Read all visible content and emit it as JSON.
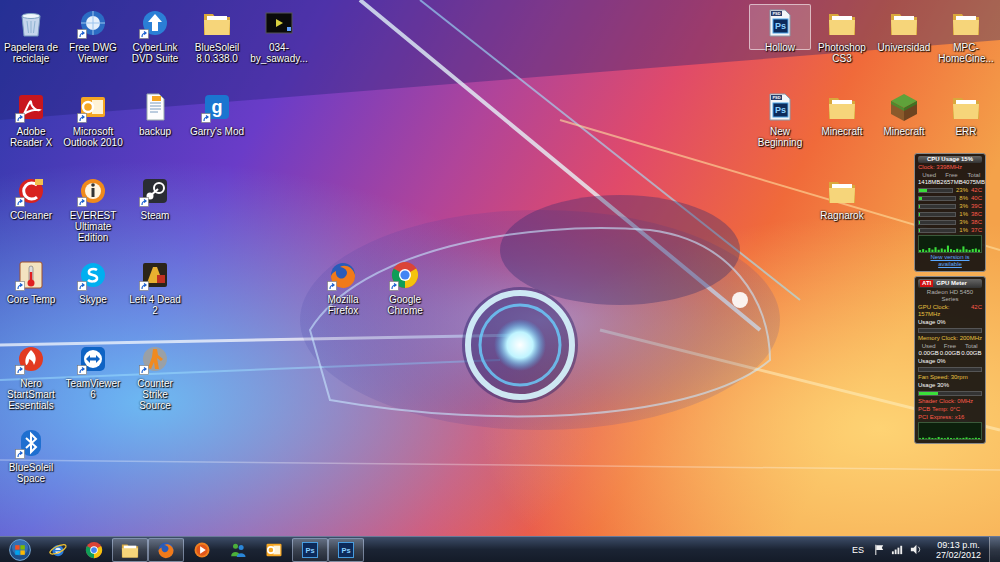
{
  "desktop": {
    "left_columns": [
      [
        {
          "label": "Papelera de reciclaje",
          "kind": "recycle",
          "shortcut": false,
          "selected": false
        },
        {
          "label": "Adobe Reader X",
          "kind": "pdf",
          "shortcut": true,
          "selected": false
        },
        {
          "label": "CCleaner",
          "kind": "ccleaner",
          "shortcut": true,
          "selected": false
        },
        {
          "label": "Core Temp",
          "kind": "coretemp",
          "shortcut": true,
          "selected": false
        },
        {
          "label": "Nero StartSmart Essentials",
          "kind": "nero",
          "shortcut": true,
          "selected": false
        },
        {
          "label": "BlueSoleil Space",
          "kind": "bluetooth",
          "shortcut": true,
          "selected": false
        }
      ],
      [
        {
          "label": "Free DWG Viewer",
          "kind": "dwg",
          "shortcut": true,
          "selected": false
        },
        {
          "label": "Microsoft Outlook 2010",
          "kind": "outlook",
          "shortcut": true,
          "selected": false
        },
        {
          "label": "EVEREST Ultimate Edition",
          "kind": "everest",
          "shortcut": true,
          "selected": false
        },
        {
          "label": "Skype",
          "kind": "skype",
          "shortcut": true,
          "selected": false
        },
        {
          "label": "TeamViewer 6",
          "kind": "teamviewer",
          "shortcut": true,
          "selected": false
        }
      ],
      [
        {
          "label": "CyberLink DVD Suite",
          "kind": "dvd",
          "shortcut": true,
          "selected": false
        },
        {
          "label": "backup",
          "kind": "document",
          "shortcut": false,
          "selected": false
        },
        {
          "label": "Steam",
          "kind": "steam",
          "shortcut": true,
          "selected": false
        },
        {
          "label": "Left 4 Dead 2",
          "kind": "l4d",
          "shortcut": true,
          "selected": false
        },
        {
          "label": "Counter Strike Source",
          "kind": "css",
          "shortcut": true,
          "selected": false
        }
      ],
      [
        {
          "label": "BlueSoleil 8.0.338.0",
          "kind": "folder",
          "shortcut": false,
          "selected": false
        },
        {
          "label": "Garry's Mod",
          "kind": "gmod",
          "glyph": "g",
          "shortcut": true,
          "selected": false
        }
      ],
      [
        {
          "label": "034-by_sawady...",
          "kind": "video",
          "shortcut": false,
          "selected": false
        }
      ]
    ],
    "middle_icons": [
      {
        "label": "Mozilla Firefox",
        "kind": "firefox",
        "shortcut": true,
        "selected": false
      },
      {
        "label": "Google Chrome",
        "kind": "chrome",
        "shortcut": true,
        "selected": false
      }
    ],
    "right_columns": [
      [
        {
          "label": "Hollow",
          "kind": "psd",
          "glyph": "Ps",
          "tag": "PSD",
          "shortcut": false,
          "selected": true
        },
        {
          "label": "New Beginning",
          "kind": "psd",
          "glyph": "Ps",
          "tag": "PSD",
          "shortcut": false,
          "selected": false
        }
      ],
      [
        {
          "label": "Photoshop CS3",
          "kind": "folder",
          "shortcut": false,
          "selected": false
        },
        {
          "label": "Minecraft",
          "kind": "folder",
          "shortcut": false,
          "selected": false
        },
        {
          "label": "Ragnarok",
          "kind": "folder",
          "shortcut": false,
          "selected": false
        }
      ],
      [
        {
          "label": "Universidad",
          "kind": "folder",
          "shortcut": false,
          "selected": false
        },
        {
          "label": "Minecraft",
          "kind": "minecraft",
          "shortcut": false,
          "selected": false
        }
      ],
      [
        {
          "label": "MPC-HomeCine...",
          "kind": "folder",
          "shortcut": false,
          "selected": false
        },
        {
          "label": "ERR",
          "kind": "folder",
          "shortcut": false,
          "selected": false
        }
      ]
    ]
  },
  "gadgets": {
    "cpu": {
      "title": "CPU Usage 15%",
      "clock": "Clock: 3398MHz",
      "columns": [
        "Used",
        "Free",
        "Total"
      ],
      "values": [
        "1418MB",
        "2657MB",
        "4075MB"
      ],
      "cores": [
        {
          "usage": "23%",
          "temp": "42C",
          "level": 0.23
        },
        {
          "usage": "8%",
          "temp": "40C",
          "level": 0.08
        },
        {
          "usage": "3%",
          "temp": "39C",
          "level": 0.03
        },
        {
          "usage": "1%",
          "temp": "38C",
          "level": 0.01
        },
        {
          "usage": "3%",
          "temp": "38C",
          "level": 0.03
        },
        {
          "usage": "1%",
          "temp": "37C",
          "level": 0.01
        }
      ],
      "history": [
        12,
        18,
        10,
        25,
        15,
        30,
        14,
        22,
        16,
        40,
        18,
        12,
        20,
        15,
        35,
        17,
        13,
        19,
        22,
        15
      ],
      "footer": "New version is available"
    },
    "gpu": {
      "brand": "ATI",
      "title": "GPU Meter",
      "model": "Radeon HD 5450 Series",
      "core": {
        "clock": "GPU Clock: 157MHz",
        "temp": "42C",
        "usage": "Usage 0%",
        "level": 0.0
      },
      "memory": {
        "clock": "Memory Clock: 200MHz",
        "columns": [
          "Used",
          "Free",
          "Total"
        ],
        "values": [
          "0.00GB",
          "0.00GB",
          "0.00GB"
        ],
        "usage": "Usage 0%",
        "level": 0.0
      },
      "fan": {
        "speed": "Fan Speed: 30rpm",
        "usage": "Usage 30%",
        "level": 0.3
      },
      "details": [
        "Shader Clock: 0MHz",
        "PCB Temp: 0°C",
        "PCI Express: x16"
      ],
      "history": [
        5,
        8,
        4,
        10,
        6,
        5,
        12,
        7,
        5,
        9,
        6,
        4,
        8,
        5,
        7,
        10,
        6,
        5,
        8,
        6
      ]
    }
  },
  "taskbar": {
    "pinned": [
      {
        "kind": "ie",
        "open": false
      },
      {
        "kind": "chrome",
        "open": false
      },
      {
        "kind": "explorer",
        "open": true
      },
      {
        "kind": "firefox",
        "open": true
      },
      {
        "kind": "mediaplayer",
        "open": false
      },
      {
        "kind": "messenger",
        "open": false
      },
      {
        "kind": "outlook",
        "open": false
      },
      {
        "kind": "ps",
        "glyph": "Ps",
        "open": true
      },
      {
        "kind": "ps",
        "glyph": "Ps",
        "open": true
      }
    ],
    "tray": {
      "language": "ES",
      "icons": [
        {
          "kind": "flag"
        },
        {
          "kind": "network"
        },
        {
          "kind": "volume"
        }
      ],
      "time": "09:13 p.m.",
      "date": "27/02/2012"
    }
  }
}
